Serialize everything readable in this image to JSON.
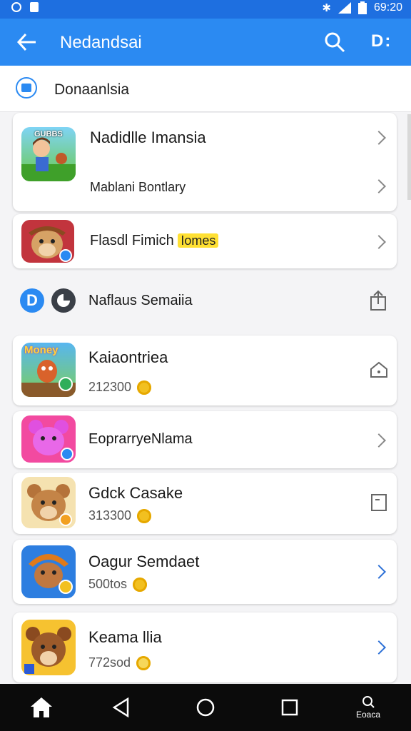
{
  "status_bar": {
    "time": "69:20",
    "icons": [
      "circle-icon",
      "lock-icon",
      "bluetooth-icon",
      "signal-icon",
      "battery-icon"
    ]
  },
  "app_bar": {
    "title": "Nedandsai",
    "back_icon": "arrow-left-icon",
    "search_icon": "search-icon",
    "menu_label": "D:"
  },
  "subheader": {
    "label": "Donaanlsia",
    "icon": "robot-icon"
  },
  "list": {
    "item1": {
      "name": "Nadidlle Imansia",
      "subtitle": "Mablani Bontlary",
      "thumb_text": "GUBBS"
    },
    "item2": {
      "name": "Flasdl Fimich",
      "tag": "Iomes"
    },
    "item3": {
      "name": "Naflaus Semaiia",
      "left_badge": "D"
    },
    "item4": {
      "name": "Kaiaontriea",
      "count": "212300",
      "thumb_text": "Money"
    },
    "item5": {
      "name": "EoprarryeNlama"
    },
    "item6": {
      "name": "Gdck Casake",
      "count": "313300"
    },
    "item7": {
      "name": "Oagur Semdaet",
      "count": "500tos"
    },
    "item8": {
      "name": "Keama llia",
      "count": "772sod"
    }
  },
  "nav": {
    "home_icon": "home-icon",
    "back_icon": "triangle-back-icon",
    "circle_icon": "circle-home-icon",
    "square_icon": "square-recents-icon",
    "extra_label": "Eoaca"
  },
  "colors": {
    "primary": "#2b8af2",
    "status_bar": "#1e6fe0",
    "highlight": "#ffe033",
    "coin": "#f2c020"
  }
}
